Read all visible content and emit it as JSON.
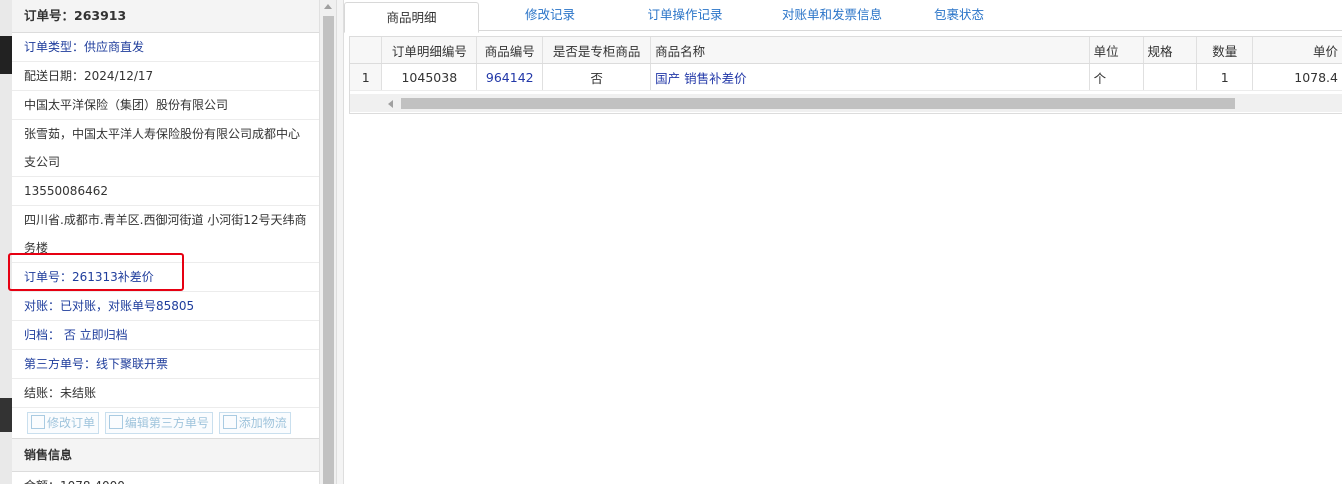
{
  "order": {
    "title_label": "订单号：",
    "title_value": "263913",
    "type": "订单类型：供应商直发",
    "delivery_date": "配送日期：2024/12/17",
    "company": "中国太平洋保险（集团）股份有限公司",
    "contact": "张雪茹，中国太平洋人寿保险股份有限公司成都中心支公司",
    "phone": "13550086462",
    "address": "四川省.成都市.青羊区.西御河街道 小河街12号天纬商务楼",
    "ref_order": "订单号：261313补差价",
    "reconcile": "对账：已对账，对账单号85805",
    "archive": "归档： 否 立即归档",
    "third_party": "第三方单号：线下聚联开票",
    "settle": "结账：未结账"
  },
  "actions": {
    "edit_order": "修改订单",
    "edit_third_party": "编辑第三方单号",
    "add_logistics": "添加物流"
  },
  "sales": {
    "title": "销售信息",
    "amount": "金额：1078.4000"
  },
  "tabs": [
    {
      "label": "商品明细"
    },
    {
      "label": "修改记录"
    },
    {
      "label": "订单操作记录"
    },
    {
      "label": "对账单和发票信息"
    },
    {
      "label": "包裹状态"
    }
  ],
  "table": {
    "headers": [
      "订单明细编号",
      "商品编号",
      "是否是专柜商品",
      "商品名称",
      "单位",
      "规格",
      "数量",
      "单价"
    ],
    "rows": [
      {
        "rownum": "1",
        "detail_id": "1045038",
        "product_id": "964142",
        "counter": "否",
        "name": "国产 销售补差价",
        "unit": "个",
        "spec": "",
        "qty": "1",
        "price": "1078.4"
      }
    ]
  }
}
